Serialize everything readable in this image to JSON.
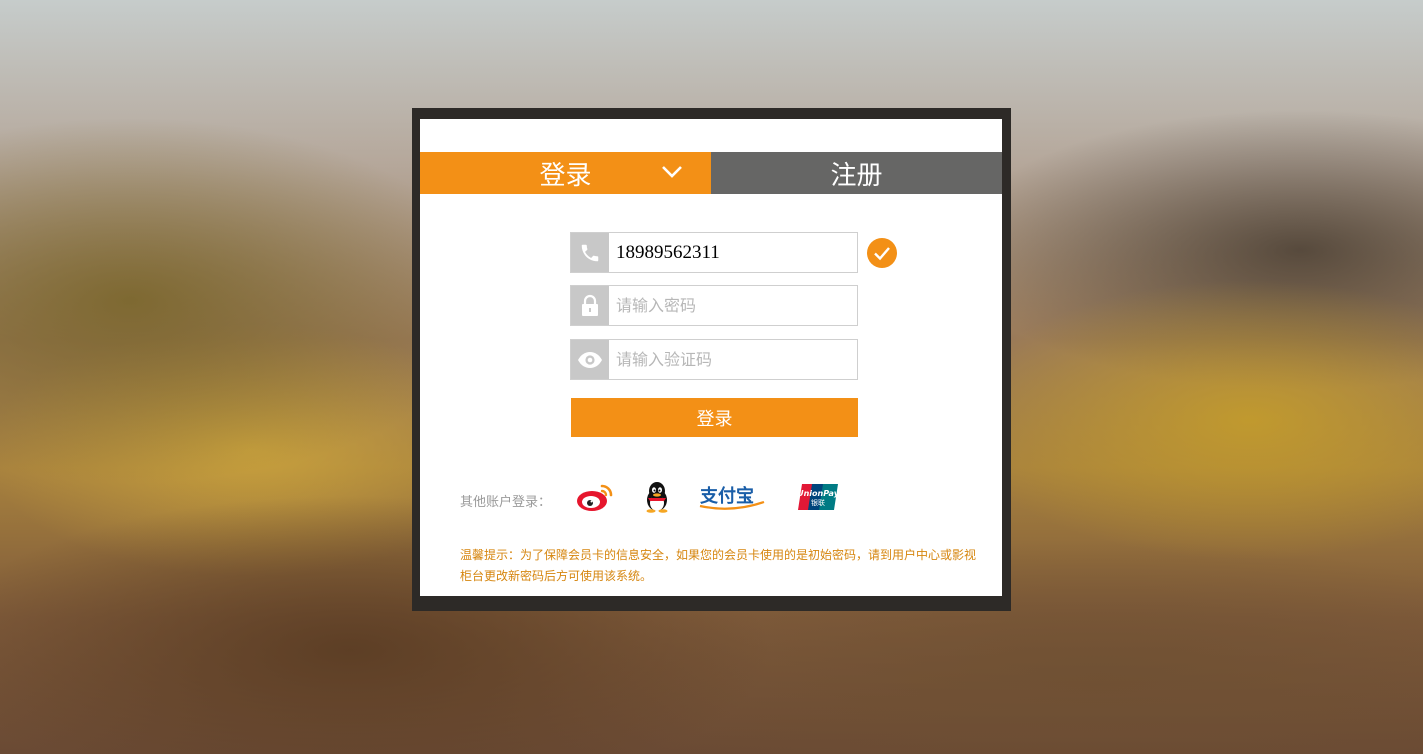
{
  "tabs": {
    "login_label": "登录",
    "register_label": "注册"
  },
  "form": {
    "phone_value": "18989562311",
    "password_placeholder": "请输入密码",
    "captcha_placeholder": "请输入验证码",
    "submit_label": "登录"
  },
  "social": {
    "label": "其他账户登录：",
    "providers": [
      "weibo-icon",
      "qq-icon",
      "alipay-icon",
      "unionpay-icon"
    ],
    "alipay_text": "支付宝",
    "unionpay_text": "UnionPay",
    "unionpay_cn": "银联"
  },
  "notice": {
    "text": "温馨提示：为了保障会员卡的信息安全，如果您的会员卡使用的是初始密码，请到用户中心或影视柜台更改新密码后方可使用该系统。"
  },
  "colors": {
    "accent": "#f39016",
    "tab_inactive": "#666665",
    "icon_bg": "#c8c8c8",
    "tip": "#d6860f"
  }
}
